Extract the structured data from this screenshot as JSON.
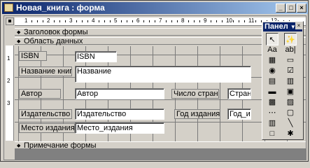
{
  "window": {
    "title": "Новая_книга : форма"
  },
  "title_buttons": {
    "minimize": "_",
    "maximize": "□",
    "close": "×"
  },
  "ruler": {
    "marks": [
      "1",
      "2",
      "3",
      "4",
      "5",
      "6",
      "7",
      "8",
      "9",
      "10",
      "11",
      "12"
    ],
    "v_marks": [
      "1",
      "2",
      "3"
    ]
  },
  "sections": {
    "header": "Заголовок формы",
    "detail": "Область данных",
    "footer": "Примечание формы"
  },
  "fields": {
    "isbn_label": "ISBN",
    "isbn_value": "ISBN",
    "title_label": "Название книги",
    "title_value": "Название",
    "author_label": "Автор",
    "author_value": "Автор",
    "pages_label": "Число страниц",
    "pages_value": "Страниц",
    "publisher_label": "Издательство",
    "publisher_value": "Издательство",
    "year_label": "Год издания",
    "year_value": "Год_издания",
    "place_label": "Место издания",
    "place_value": "Место_издания"
  },
  "toolbox": {
    "title": "Панел",
    "icons": [
      "select-pointer-icon",
      "wizard-icon",
      "label-tool-icon",
      "textbox-tool-icon",
      "option-group-icon",
      "toggle-button-icon",
      "option-button-icon",
      "checkbox-icon",
      "combobox-icon",
      "listbox-icon",
      "command-button-icon",
      "image-tool-icon",
      "unbound-frame-icon",
      "bound-frame-icon",
      "page-break-icon",
      "tab-control-icon",
      "subform-icon",
      "line-tool-icon",
      "rectangle-tool-icon",
      "more-controls-icon"
    ],
    "glyphs": [
      "↖",
      "✨",
      "Aa",
      "ab|",
      "▦",
      "▭",
      "◉",
      "☑",
      "▤",
      "▥",
      "▬",
      "▣",
      "▩",
      "▨",
      "⋯",
      "▢",
      "▥",
      "╲",
      "□",
      "✱"
    ]
  }
}
